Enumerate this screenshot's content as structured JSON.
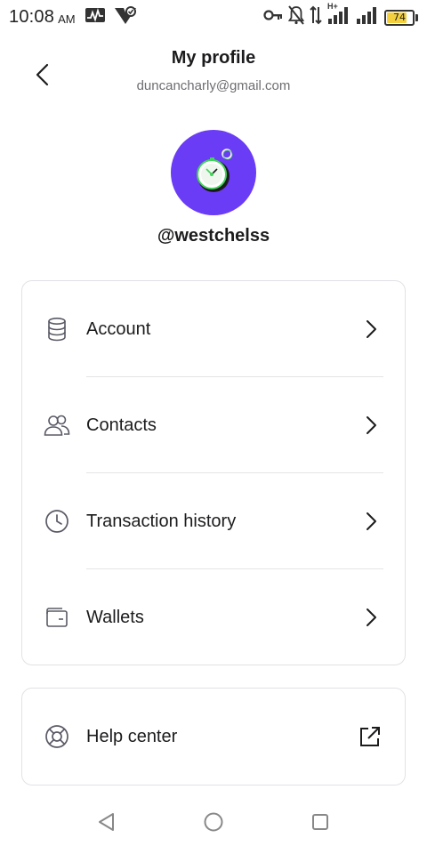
{
  "status_bar": {
    "time": "10:08",
    "ampm": "AM",
    "battery": "74",
    "network_label": "H+"
  },
  "header": {
    "title": "My profile",
    "email": "duncancharly@gmail.com"
  },
  "profile": {
    "username": "@westchelss",
    "avatar_bg": "#6b3cf5"
  },
  "menu": {
    "items": [
      {
        "label": "Account",
        "icon": "database-icon"
      },
      {
        "label": "Contacts",
        "icon": "users-icon"
      },
      {
        "label": "Transaction history",
        "icon": "clock-icon"
      },
      {
        "label": "Wallets",
        "icon": "wallet-icon"
      }
    ],
    "help": {
      "label": "Help center",
      "icon": "lifebuoy-icon"
    }
  },
  "nav": {
    "buttons": [
      "back-triangle-icon",
      "home-circle-icon",
      "recents-square-icon"
    ]
  }
}
